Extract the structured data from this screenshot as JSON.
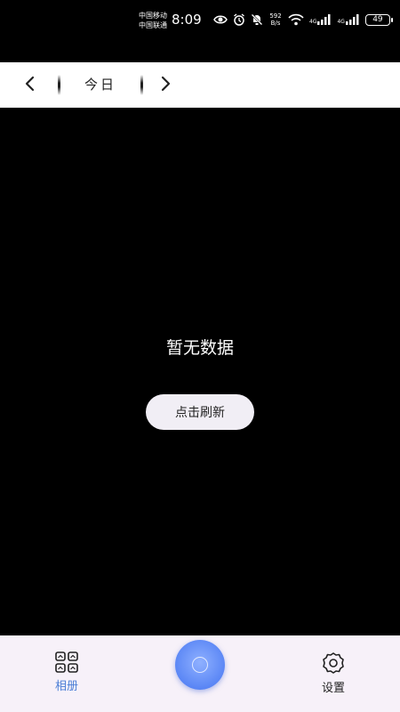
{
  "status_bar": {
    "carrier_1": "中国移动",
    "carrier_2": "中国联通",
    "time": "8:09",
    "net_speed_value": "592",
    "net_speed_unit": "B/s",
    "sim1_label": "4G",
    "sim2_label": "4G",
    "battery": "49"
  },
  "date_nav": {
    "label": "今日",
    "prev_icon": "chevron-left-icon",
    "next_icon": "chevron-right-icon"
  },
  "main": {
    "empty_text": "暂无数据",
    "refresh_label": "点击刷新"
  },
  "tab_bar": {
    "album_label": "相册",
    "album_icon": "grid-icon",
    "settings_label": "设置",
    "settings_icon": "gear-icon",
    "center_icon": "circle-icon"
  },
  "colors": {
    "accent": "#4c7fd6",
    "center_button": "#5a86f5",
    "tab_bar_bg": "#f7f1f9",
    "refresh_bg": "#f1eef5"
  }
}
